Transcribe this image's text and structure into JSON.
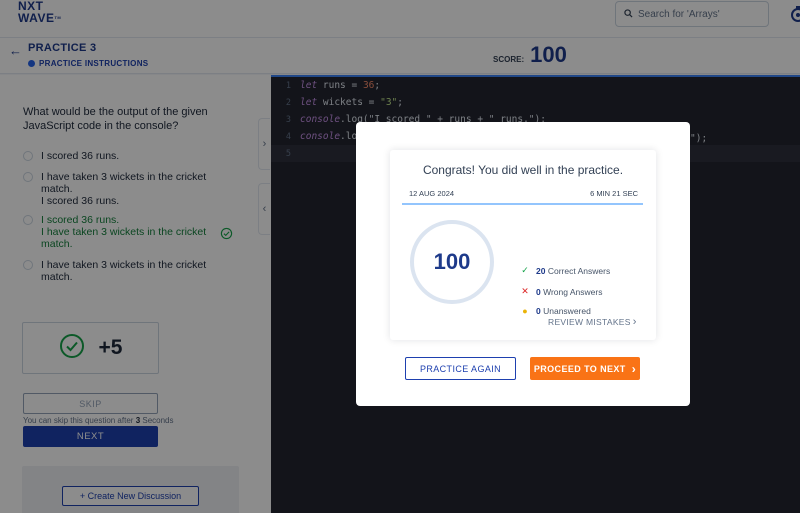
{
  "header": {
    "logo_line1": "NXT",
    "logo_line2": "WAVE",
    "logo_tm": "TM",
    "search_placeholder": "Search for 'Arrays'"
  },
  "practice": {
    "title": "PRACTICE 3",
    "instructions_label": "PRACTICE INSTRUCTIONS",
    "score_label": "SCORE:",
    "score_value": "100"
  },
  "question": {
    "text": "What would be the output of the given JavaScript code in the console?",
    "options": [
      {
        "text": "I scored 36 runs.",
        "state": "default"
      },
      {
        "text": "I have taken 3 wickets in the cricket match.\nI scored 36 runs.",
        "state": "default"
      },
      {
        "text": "I scored 36 runs.\nI have taken 3 wickets in the cricket match.",
        "state": "correct"
      },
      {
        "text": "I have taken 3 wickets in the cricket match.",
        "state": "default"
      }
    ],
    "points": "+5",
    "skip_label": "SKIP",
    "skip_note_prefix": "You can skip this question after",
    "skip_note_seconds": "3",
    "skip_note_suffix": "Seconds",
    "next_label": "NEXT",
    "create_discussion_label": "+ Create New Discussion"
  },
  "editor": {
    "lines": [
      "1",
      "2",
      "3",
      "4",
      "5"
    ],
    "line1": {
      "kw": "let",
      "name": " runs",
      "op": " = ",
      "val": "36",
      "end": ";"
    },
    "line2": {
      "kw": "let",
      "name": " wickets",
      "op": " = ",
      "val": "\"3\"",
      "end": ";"
    },
    "line3": {
      "obj": "console",
      "rest": ".log(\"I scored \" + runs + \" runs.\");"
    },
    "line4": {
      "obj": "console",
      "rest": ".lo"
    },
    "line4_tail": "\");"
  },
  "modal": {
    "title": "Congrats! You did well in the practice.",
    "date": "12 AUG 2024",
    "duration": "6 MIN 21 SEC",
    "score": "100",
    "stats": [
      {
        "count": "20",
        "label": "Correct Answers",
        "icon": "check-icon",
        "color": "#16a34a"
      },
      {
        "count": "0",
        "label": "Wrong Answers",
        "icon": "cross-icon",
        "color": "#dc2626"
      },
      {
        "count": "0",
        "label": "Unanswered",
        "icon": "dot-icon",
        "color": "#eab308"
      }
    ],
    "review_label": "REVIEW MISTAKES",
    "practice_again_label": "PRACTICE AGAIN",
    "proceed_label": "PROCEED TO NEXT"
  },
  "colors": {
    "brand": "#1e3a8a",
    "accent": "#f97316",
    "correct": "#15803d"
  }
}
